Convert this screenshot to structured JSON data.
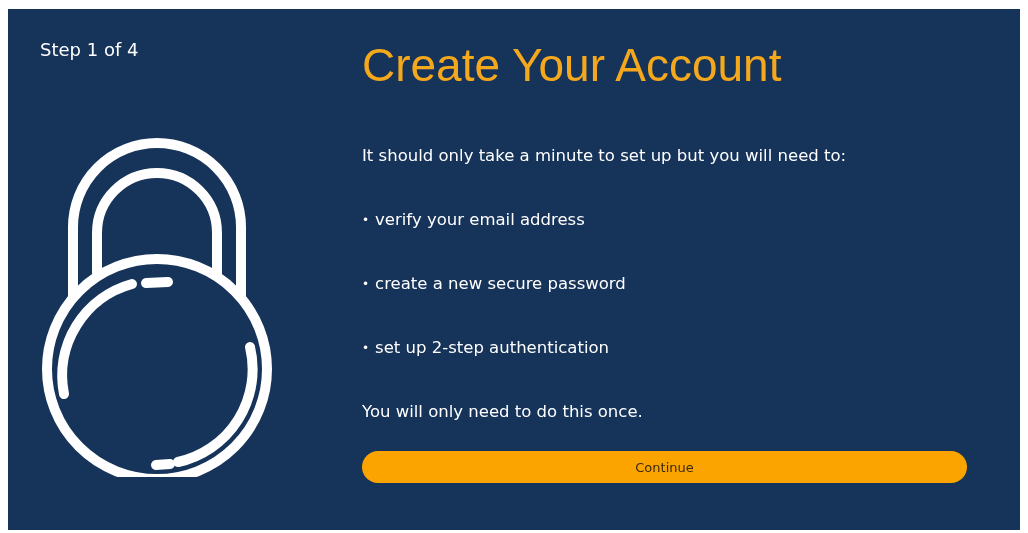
{
  "step": "Step 1 of 4",
  "title": "Create Your Account",
  "intro": "It should only take a minute to set up but you will need to:",
  "items": [
    {
      "marker": "•",
      "text": "verify your email address"
    },
    {
      "marker": "•",
      "text": "create a new secure password"
    },
    {
      "marker": "•",
      "text": "set up 2-step authentication"
    }
  ],
  "note": "You will only need to do this once.",
  "button": "Continue"
}
